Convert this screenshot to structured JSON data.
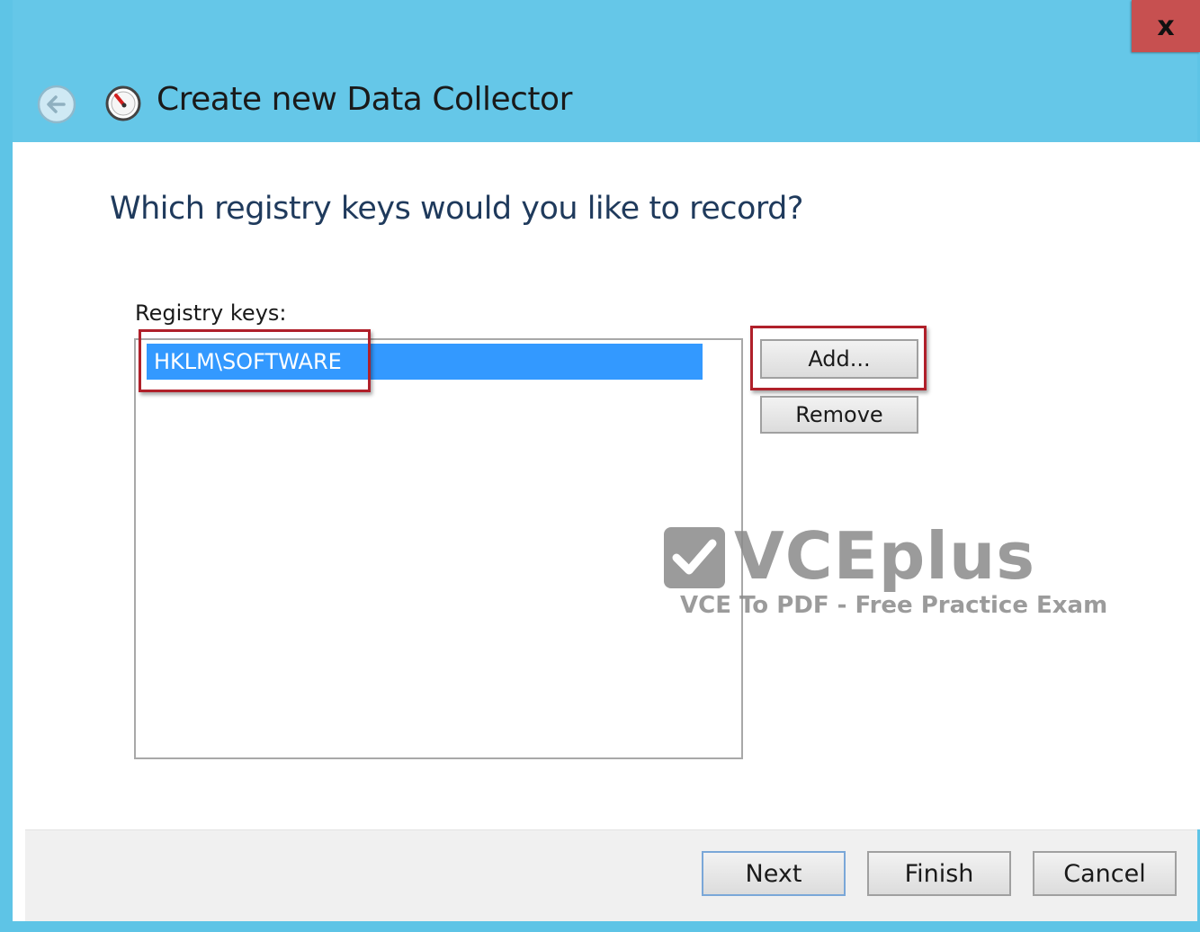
{
  "window": {
    "title": "Create new Data Collector",
    "close_label": "x",
    "back_icon": "back-arrow-icon",
    "app_icon": "data-collector-icon",
    "accent_color": "#65c7e8"
  },
  "page": {
    "heading": "Which registry keys would you like to record?"
  },
  "registry": {
    "label": "Registry keys:",
    "items": [
      "HKLM\\SOFTWARE"
    ],
    "selected_color": "#3399ff"
  },
  "actions": {
    "add_label": "Add...",
    "remove_label": "Remove"
  },
  "footer": {
    "next_label": "Next",
    "finish_label": "Finish",
    "cancel_label": "Cancel"
  },
  "watermark": {
    "brand": "VCEplus",
    "tagline": "VCE To PDF - Free Practice Exam"
  }
}
